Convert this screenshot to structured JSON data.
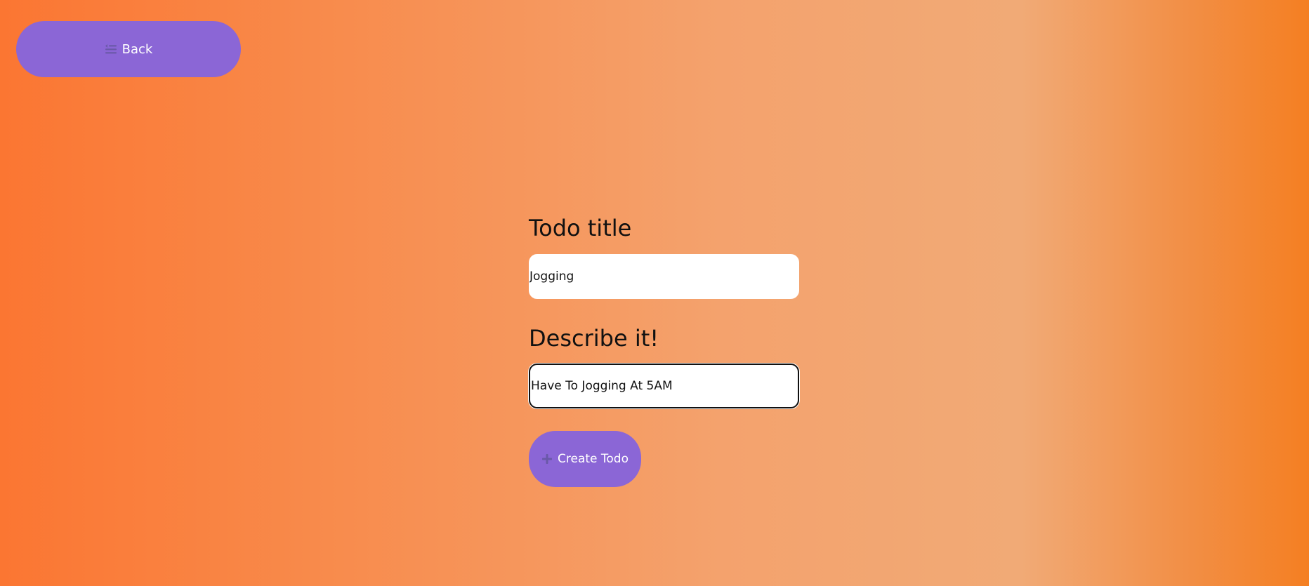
{
  "back_button": {
    "label": "Back",
    "icon": "back-list-icon"
  },
  "form": {
    "title_label": "Todo title",
    "title_value": "Jogging",
    "description_label": "Describe it!",
    "description_value": "Have To Jogging At 5AM",
    "create_button": {
      "label": "Create Todo",
      "icon": "plus-icon"
    }
  },
  "colors": {
    "button": "#8b66d6",
    "icon": "#6a58a8",
    "text": "#111111",
    "field_background": "#ffffff",
    "gradient": [
      "#fb7632",
      "#f4a26d",
      "#f47f22"
    ]
  }
}
